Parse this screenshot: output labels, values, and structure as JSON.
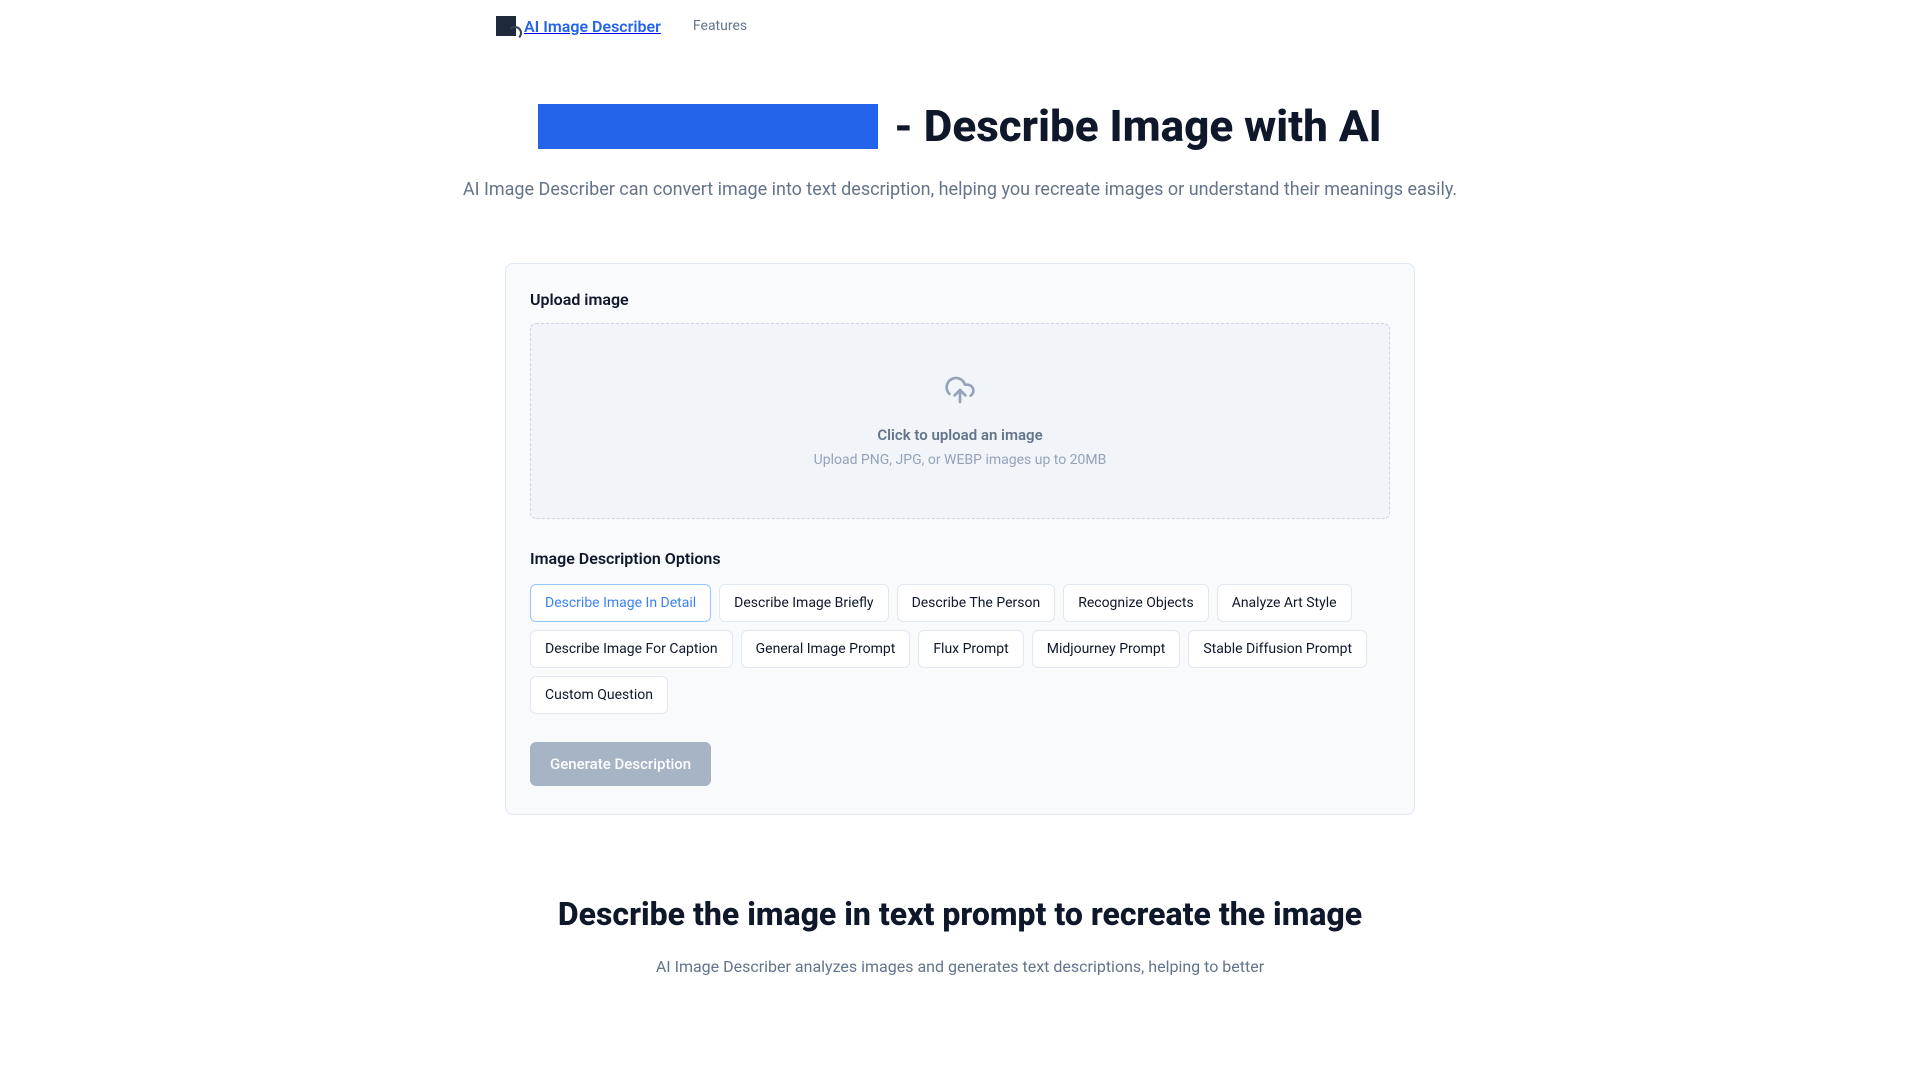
{
  "header": {
    "logo_text": "AI Image Describer",
    "nav_features": "Features"
  },
  "hero": {
    "title_suffix": "- Describe Image with AI",
    "subtitle": "AI Image Describer can convert image into text description, helping you recreate images or understand their meanings easily."
  },
  "upload": {
    "section_title": "Upload image",
    "main_text": "Click to upload an image",
    "hint_text": "Upload PNG, JPG, or WEBP images up to 20MB"
  },
  "options": {
    "title": "Image Description Options",
    "items": [
      "Describe Image In Detail",
      "Describe Image Briefly",
      "Describe The Person",
      "Recognize Objects",
      "Analyze Art Style",
      "Describe Image For Caption",
      "General Image Prompt",
      "Flux Prompt",
      "Midjourney Prompt",
      "Stable Diffusion Prompt",
      "Custom Question"
    ]
  },
  "generate_label": "Generate Description",
  "bottom": {
    "title": "Describe the image in text prompt to recreate the image",
    "text": "AI Image Describer analyzes images and generates text descriptions, helping to better"
  }
}
